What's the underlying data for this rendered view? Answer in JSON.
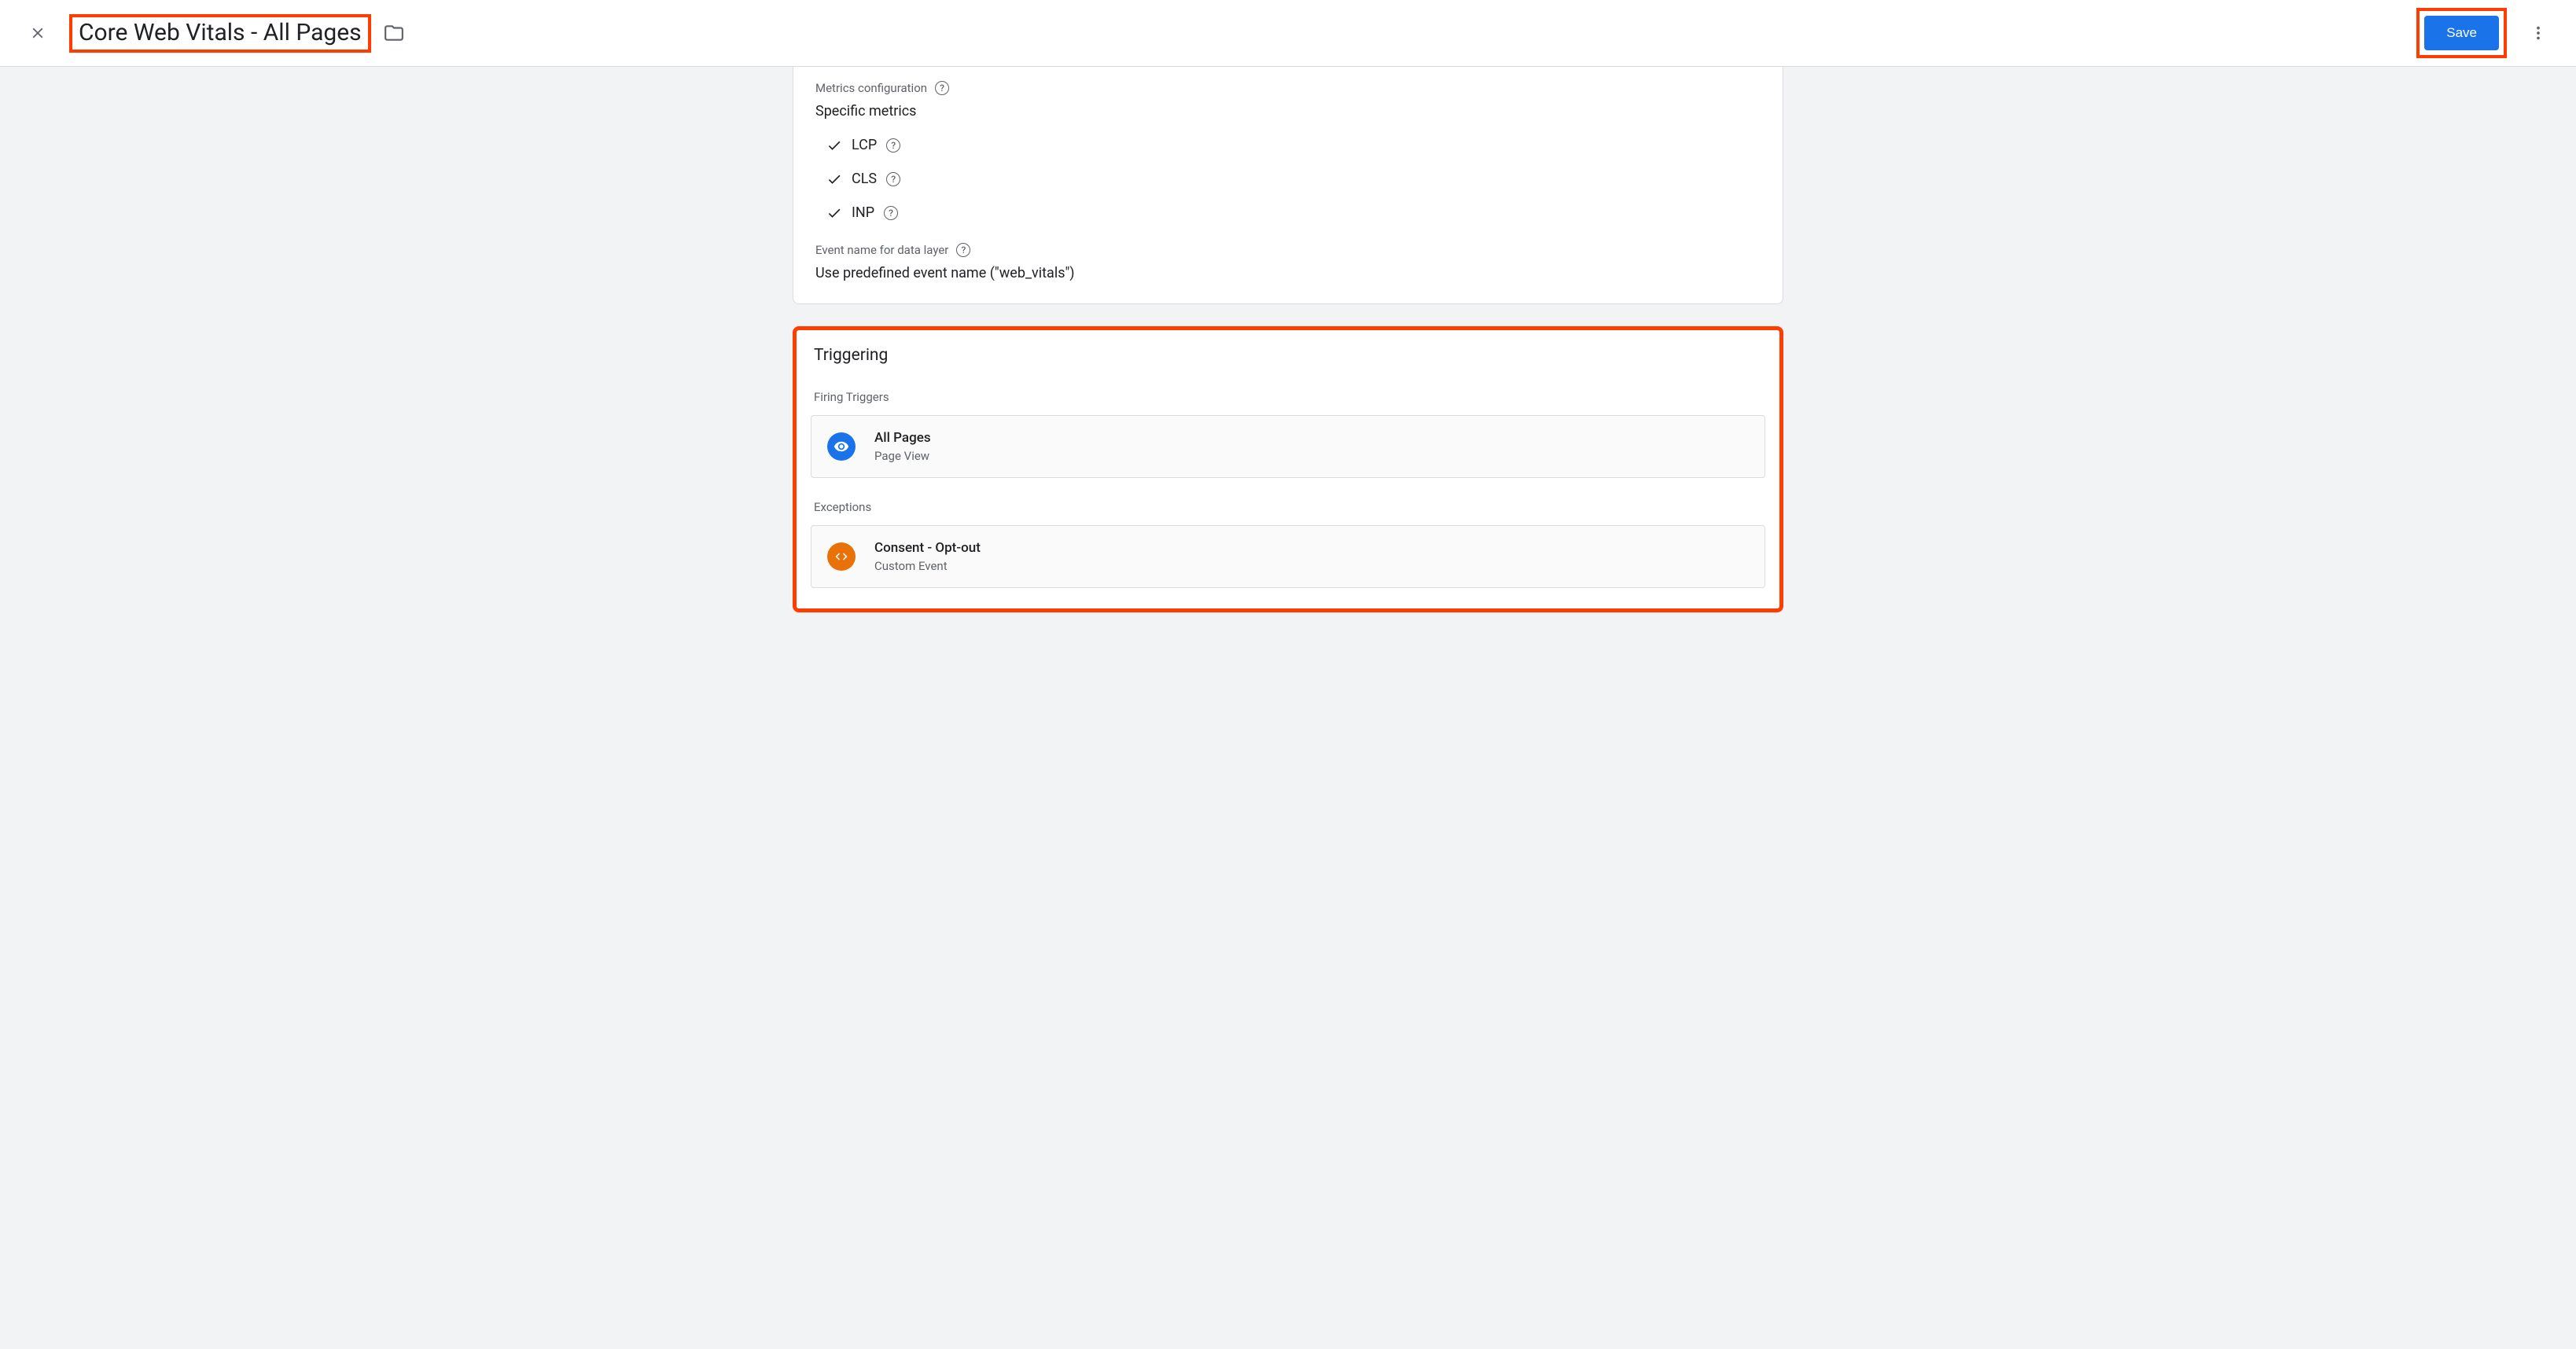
{
  "header": {
    "title": "Core Web Vitals - All Pages",
    "save_label": "Save"
  },
  "metrics": {
    "label": "Metrics configuration",
    "value": "Specific metrics",
    "items": [
      "LCP",
      "CLS",
      "INP"
    ]
  },
  "event_name": {
    "label": "Event name for data layer",
    "value": "Use predefined event name (\"web_vitals\")"
  },
  "triggering": {
    "heading": "Triggering",
    "firing_label": "Firing Triggers",
    "exceptions_label": "Exceptions",
    "firing": {
      "name": "All Pages",
      "type": "Page View"
    },
    "exception": {
      "name": "Consent - Opt-out",
      "type": "Custom Event"
    }
  }
}
